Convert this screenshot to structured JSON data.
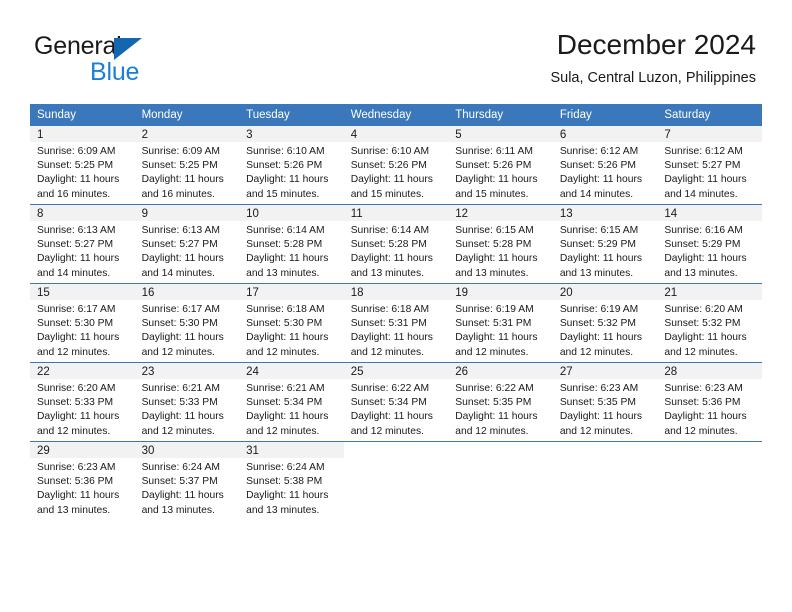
{
  "logo": {
    "word_top": "General",
    "word_bottom": "Blue",
    "triangle_icon": "blue-triangle-icon",
    "color_dark": "#1a1a1a",
    "color_blue": "#1c7fd4"
  },
  "header": {
    "title": "December 2024",
    "subtitle": "Sula, Central Luzon, Philippines"
  },
  "colors": {
    "header_band": "#3a77bb",
    "daynum_band": "#f2f2f2",
    "text": "#1a1a1a"
  },
  "calendar": {
    "weekday_headers": [
      "Sunday",
      "Monday",
      "Tuesday",
      "Wednesday",
      "Thursday",
      "Friday",
      "Saturday"
    ],
    "weeks": [
      [
        {
          "day": "1",
          "sunrise": "Sunrise: 6:09 AM",
          "sunset": "Sunset: 5:25 PM",
          "daylight1": "Daylight: 11 hours",
          "daylight2": "and 16 minutes."
        },
        {
          "day": "2",
          "sunrise": "Sunrise: 6:09 AM",
          "sunset": "Sunset: 5:25 PM",
          "daylight1": "Daylight: 11 hours",
          "daylight2": "and 16 minutes."
        },
        {
          "day": "3",
          "sunrise": "Sunrise: 6:10 AM",
          "sunset": "Sunset: 5:26 PM",
          "daylight1": "Daylight: 11 hours",
          "daylight2": "and 15 minutes."
        },
        {
          "day": "4",
          "sunrise": "Sunrise: 6:10 AM",
          "sunset": "Sunset: 5:26 PM",
          "daylight1": "Daylight: 11 hours",
          "daylight2": "and 15 minutes."
        },
        {
          "day": "5",
          "sunrise": "Sunrise: 6:11 AM",
          "sunset": "Sunset: 5:26 PM",
          "daylight1": "Daylight: 11 hours",
          "daylight2": "and 15 minutes."
        },
        {
          "day": "6",
          "sunrise": "Sunrise: 6:12 AM",
          "sunset": "Sunset: 5:26 PM",
          "daylight1": "Daylight: 11 hours",
          "daylight2": "and 14 minutes."
        },
        {
          "day": "7",
          "sunrise": "Sunrise: 6:12 AM",
          "sunset": "Sunset: 5:27 PM",
          "daylight1": "Daylight: 11 hours",
          "daylight2": "and 14 minutes."
        }
      ],
      [
        {
          "day": "8",
          "sunrise": "Sunrise: 6:13 AM",
          "sunset": "Sunset: 5:27 PM",
          "daylight1": "Daylight: 11 hours",
          "daylight2": "and 14 minutes."
        },
        {
          "day": "9",
          "sunrise": "Sunrise: 6:13 AM",
          "sunset": "Sunset: 5:27 PM",
          "daylight1": "Daylight: 11 hours",
          "daylight2": "and 14 minutes."
        },
        {
          "day": "10",
          "sunrise": "Sunrise: 6:14 AM",
          "sunset": "Sunset: 5:28 PM",
          "daylight1": "Daylight: 11 hours",
          "daylight2": "and 13 minutes."
        },
        {
          "day": "11",
          "sunrise": "Sunrise: 6:14 AM",
          "sunset": "Sunset: 5:28 PM",
          "daylight1": "Daylight: 11 hours",
          "daylight2": "and 13 minutes."
        },
        {
          "day": "12",
          "sunrise": "Sunrise: 6:15 AM",
          "sunset": "Sunset: 5:28 PM",
          "daylight1": "Daylight: 11 hours",
          "daylight2": "and 13 minutes."
        },
        {
          "day": "13",
          "sunrise": "Sunrise: 6:15 AM",
          "sunset": "Sunset: 5:29 PM",
          "daylight1": "Daylight: 11 hours",
          "daylight2": "and 13 minutes."
        },
        {
          "day": "14",
          "sunrise": "Sunrise: 6:16 AM",
          "sunset": "Sunset: 5:29 PM",
          "daylight1": "Daylight: 11 hours",
          "daylight2": "and 13 minutes."
        }
      ],
      [
        {
          "day": "15",
          "sunrise": "Sunrise: 6:17 AM",
          "sunset": "Sunset: 5:30 PM",
          "daylight1": "Daylight: 11 hours",
          "daylight2": "and 12 minutes."
        },
        {
          "day": "16",
          "sunrise": "Sunrise: 6:17 AM",
          "sunset": "Sunset: 5:30 PM",
          "daylight1": "Daylight: 11 hours",
          "daylight2": "and 12 minutes."
        },
        {
          "day": "17",
          "sunrise": "Sunrise: 6:18 AM",
          "sunset": "Sunset: 5:30 PM",
          "daylight1": "Daylight: 11 hours",
          "daylight2": "and 12 minutes."
        },
        {
          "day": "18",
          "sunrise": "Sunrise: 6:18 AM",
          "sunset": "Sunset: 5:31 PM",
          "daylight1": "Daylight: 11 hours",
          "daylight2": "and 12 minutes."
        },
        {
          "day": "19",
          "sunrise": "Sunrise: 6:19 AM",
          "sunset": "Sunset: 5:31 PM",
          "daylight1": "Daylight: 11 hours",
          "daylight2": "and 12 minutes."
        },
        {
          "day": "20",
          "sunrise": "Sunrise: 6:19 AM",
          "sunset": "Sunset: 5:32 PM",
          "daylight1": "Daylight: 11 hours",
          "daylight2": "and 12 minutes."
        },
        {
          "day": "21",
          "sunrise": "Sunrise: 6:20 AM",
          "sunset": "Sunset: 5:32 PM",
          "daylight1": "Daylight: 11 hours",
          "daylight2": "and 12 minutes."
        }
      ],
      [
        {
          "day": "22",
          "sunrise": "Sunrise: 6:20 AM",
          "sunset": "Sunset: 5:33 PM",
          "daylight1": "Daylight: 11 hours",
          "daylight2": "and 12 minutes."
        },
        {
          "day": "23",
          "sunrise": "Sunrise: 6:21 AM",
          "sunset": "Sunset: 5:33 PM",
          "daylight1": "Daylight: 11 hours",
          "daylight2": "and 12 minutes."
        },
        {
          "day": "24",
          "sunrise": "Sunrise: 6:21 AM",
          "sunset": "Sunset: 5:34 PM",
          "daylight1": "Daylight: 11 hours",
          "daylight2": "and 12 minutes."
        },
        {
          "day": "25",
          "sunrise": "Sunrise: 6:22 AM",
          "sunset": "Sunset: 5:34 PM",
          "daylight1": "Daylight: 11 hours",
          "daylight2": "and 12 minutes."
        },
        {
          "day": "26",
          "sunrise": "Sunrise: 6:22 AM",
          "sunset": "Sunset: 5:35 PM",
          "daylight1": "Daylight: 11 hours",
          "daylight2": "and 12 minutes."
        },
        {
          "day": "27",
          "sunrise": "Sunrise: 6:23 AM",
          "sunset": "Sunset: 5:35 PM",
          "daylight1": "Daylight: 11 hours",
          "daylight2": "and 12 minutes."
        },
        {
          "day": "28",
          "sunrise": "Sunrise: 6:23 AM",
          "sunset": "Sunset: 5:36 PM",
          "daylight1": "Daylight: 11 hours",
          "daylight2": "and 12 minutes."
        }
      ],
      [
        {
          "day": "29",
          "sunrise": "Sunrise: 6:23 AM",
          "sunset": "Sunset: 5:36 PM",
          "daylight1": "Daylight: 11 hours",
          "daylight2": "and 13 minutes."
        },
        {
          "day": "30",
          "sunrise": "Sunrise: 6:24 AM",
          "sunset": "Sunset: 5:37 PM",
          "daylight1": "Daylight: 11 hours",
          "daylight2": "and 13 minutes."
        },
        {
          "day": "31",
          "sunrise": "Sunrise: 6:24 AM",
          "sunset": "Sunset: 5:38 PM",
          "daylight1": "Daylight: 11 hours",
          "daylight2": "and 13 minutes."
        },
        {
          "day": "",
          "sunrise": "",
          "sunset": "",
          "daylight1": "",
          "daylight2": ""
        },
        {
          "day": "",
          "sunrise": "",
          "sunset": "",
          "daylight1": "",
          "daylight2": ""
        },
        {
          "day": "",
          "sunrise": "",
          "sunset": "",
          "daylight1": "",
          "daylight2": ""
        },
        {
          "day": "",
          "sunrise": "",
          "sunset": "",
          "daylight1": "",
          "daylight2": ""
        }
      ]
    ]
  }
}
